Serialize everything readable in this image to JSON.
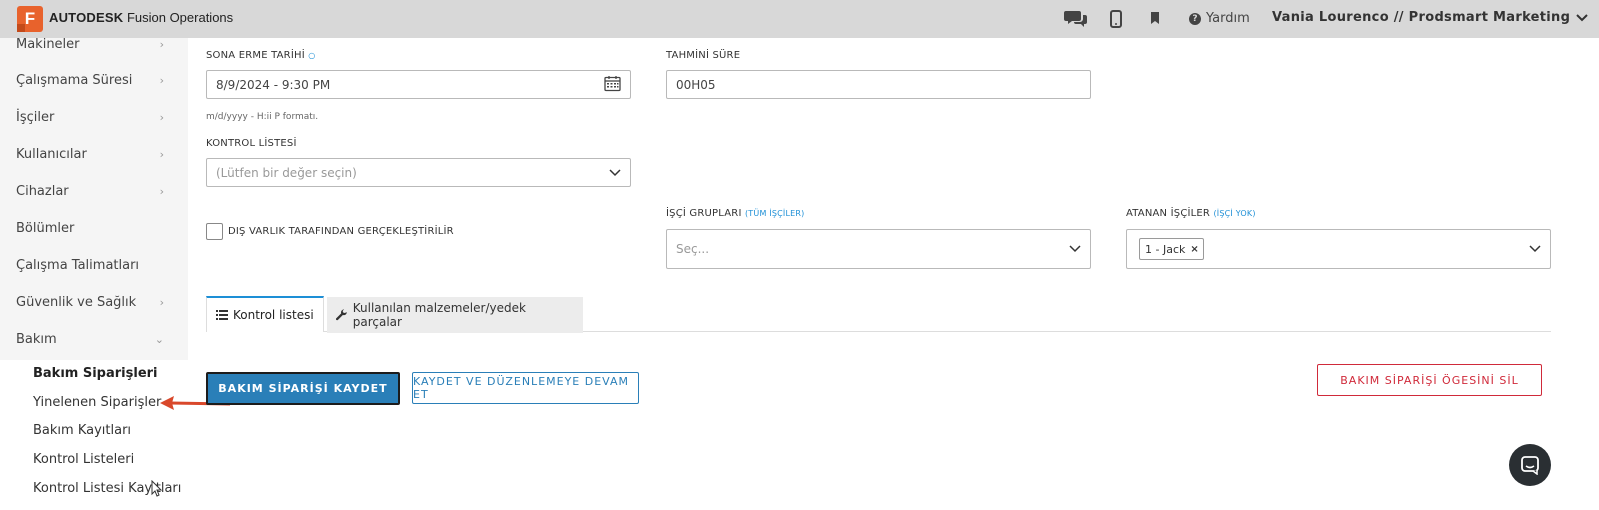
{
  "app": {
    "logo_letter": "F",
    "brand_bold": "AUTODESK",
    "brand_rest": "Fusion Operations"
  },
  "topbar": {
    "help_label": "Yardım",
    "user_label": "Vania Lourenco // Prodsmart Marketing"
  },
  "sidebar": {
    "items": [
      {
        "label": "Makineler",
        "chevron": "›"
      },
      {
        "label": "Çalışmama Süresi",
        "chevron": "›"
      },
      {
        "label": "İşçiler",
        "chevron": "›"
      },
      {
        "label": "Kullanıcılar",
        "chevron": "›"
      },
      {
        "label": "Cihazlar",
        "chevron": "›"
      },
      {
        "label": "Bölümler",
        "chevron": ""
      },
      {
        "label": "Çalışma Talimatları",
        "chevron": ""
      },
      {
        "label": "Güvenlik ve Sağlık",
        "chevron": "›"
      },
      {
        "label": "Bakım",
        "chevron": "⌄"
      }
    ],
    "sub_items": [
      {
        "label": "Bakım Siparişleri"
      },
      {
        "label": "Yinelenen Siparişler"
      },
      {
        "label": "Bakım Kayıtları"
      },
      {
        "label": "Kontrol Listeleri"
      },
      {
        "label": "Kontrol Listesi Kayıtları"
      }
    ]
  },
  "form": {
    "due_date": {
      "label": "SONA ERME TARİHİ",
      "hint": "○",
      "value": "8/9/2024 - 9:30 PM",
      "note": "m/d/yyyy - H:ii P formatı."
    },
    "estimated_time": {
      "label": "TAHMİNİ SÜRE",
      "value": "00H05"
    },
    "checklist": {
      "label": "KONTROL LİSTESİ",
      "placeholder": "(Lütfen bir değer seçin)"
    },
    "external": {
      "label": "DIŞ VARLIK TARAFINDAN GERÇEKLEŞTİRİLİR"
    },
    "worker_groups": {
      "label": "İŞÇİ GRUPLARI",
      "hint": "(TÜM İŞÇİLER)",
      "placeholder": "Seç..."
    },
    "assigned_workers": {
      "label": "ATANAN İŞÇİLER",
      "hint": "(İŞÇİ YOK)",
      "tag": "1 - Jack",
      "tag_remove": "×"
    }
  },
  "tabs": [
    {
      "label": "Kontrol listesi",
      "icon": "list-icon"
    },
    {
      "label": "Kullanılan malzemeler/yedek parçalar",
      "icon": "wrench-icon"
    }
  ],
  "actions": {
    "save": "BAKIM SİPARİŞİ KAYDET",
    "save_continue": "KAYDET VE DÜZENLEMEYE DEVAM ET",
    "delete": "BAKIM SİPARİŞİ ÖGESİNİ SİL"
  },
  "colors": {
    "accent": "#2a7fb8",
    "link": "#1d8fd6",
    "danger": "#d02a3a",
    "logo": "#e8622c",
    "arrow": "#d9482b"
  }
}
